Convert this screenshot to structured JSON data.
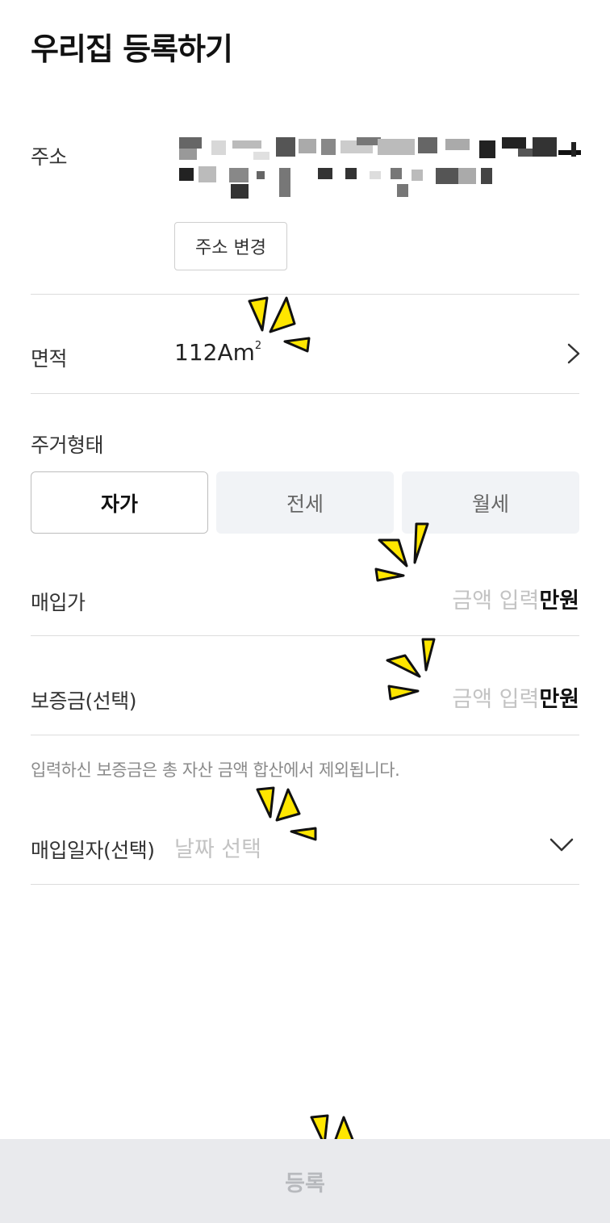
{
  "header": {
    "title": "우리집 등록하기"
  },
  "address": {
    "label": "주소",
    "change_button": "주소 변경"
  },
  "area": {
    "label": "면적",
    "value": "112Am",
    "unit_superscript": "2"
  },
  "housing_type": {
    "label": "주거형태",
    "options": [
      "자가",
      "전세",
      "월세"
    ],
    "selected": "자가"
  },
  "purchase_price": {
    "label": "매입가",
    "placeholder": "금액 입력",
    "unit": "만원"
  },
  "deposit": {
    "label": "보증금(선택)",
    "placeholder": "금액 입력",
    "unit": "만원",
    "note": "입력하신 보증금은 총 자산 금액 합산에서 제외됩니다."
  },
  "purchase_date": {
    "label": "매입일자(선택)",
    "placeholder": "날짜 선택"
  },
  "footer": {
    "submit_label": "등록"
  },
  "icons": {
    "area_chevron": "chevron-right-icon",
    "date_chevron": "chevron-down-icon",
    "sparkle": "sparkle-icon"
  },
  "colors": {
    "sparkle_fill": "#ffe600",
    "selected_border": "#bdbdbd",
    "inactive_segment": "#f1f3f6",
    "bottom_bar": "#e9eaed"
  }
}
